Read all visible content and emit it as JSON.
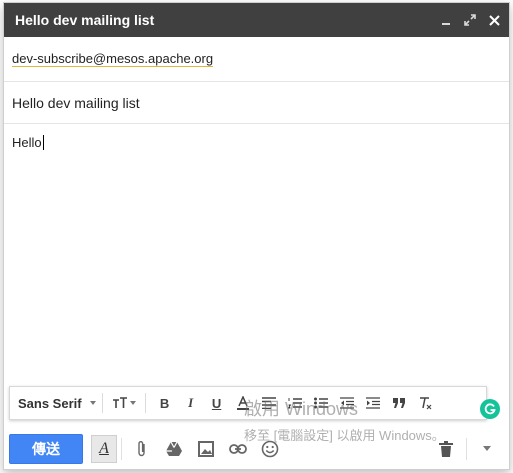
{
  "window": {
    "title": "Hello dev mailing list",
    "minimize_icon": "minimize-icon",
    "popout_icon": "popout-icon",
    "close_icon": "close-icon"
  },
  "compose": {
    "to": "dev-subscribe@mesos.apache.org",
    "subject": "Hello dev mailing list",
    "body": "Hello"
  },
  "format_toolbar": {
    "font_family": "Sans Serif",
    "buttons": [
      "font-size",
      "bold",
      "italic",
      "underline",
      "text-color",
      "align",
      "numbered-list",
      "bulleted-list",
      "indent-less",
      "indent-more",
      "quote",
      "remove-formatting"
    ]
  },
  "bottom_toolbar": {
    "send_label": "傳送",
    "send_color": "#4285f4",
    "icons": [
      "formatting-options-icon",
      "attach-icon",
      "drive-icon",
      "photo-icon",
      "link-icon",
      "emoji-icon",
      "trash-icon",
      "more-options-icon"
    ]
  },
  "overlay": {
    "watermark_line1": "啟用 Windows",
    "watermark_line2": "移至 [電腦設定] 以啟用 Windows。"
  },
  "colors": {
    "titlebar": "#404040",
    "grammarly": "#15c39a"
  }
}
